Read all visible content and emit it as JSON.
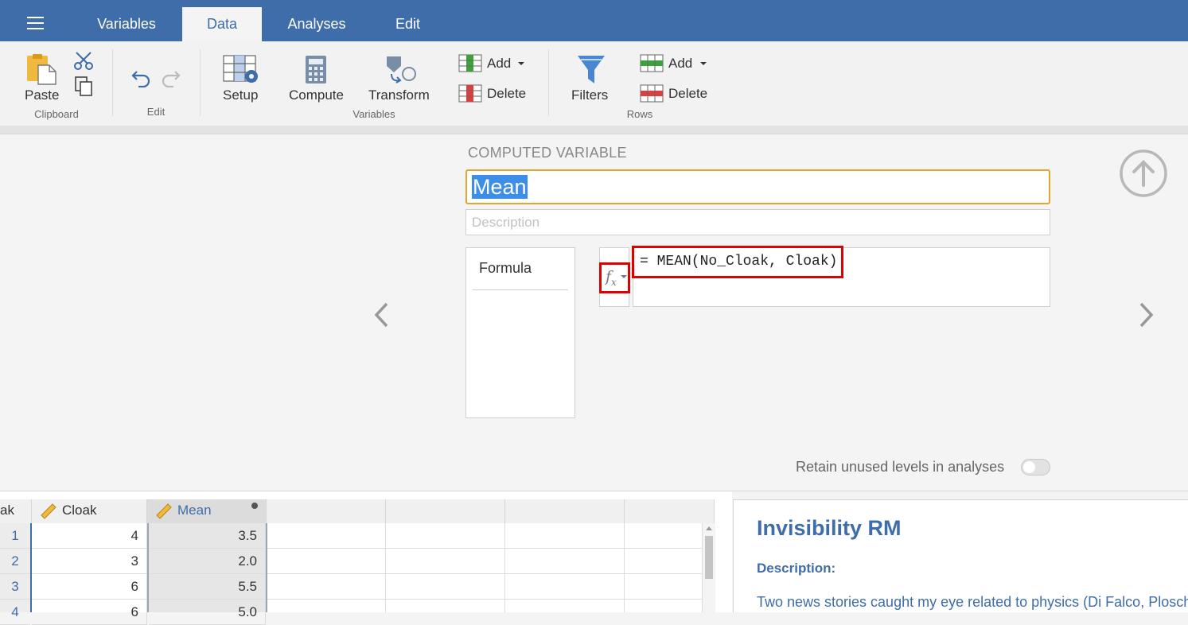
{
  "tabs": [
    {
      "label": "Variables"
    },
    {
      "label": "Data"
    },
    {
      "label": "Analyses"
    },
    {
      "label": "Edit"
    }
  ],
  "ribbon": {
    "paste": "Paste",
    "clipboard_group": "Clipboard",
    "edit_group": "Edit",
    "setup": "Setup",
    "compute": "Compute",
    "transform": "Transform",
    "var_add": "Add",
    "var_delete": "Delete",
    "variables_group": "Variables",
    "filters": "Filters",
    "row_add": "Add",
    "row_delete": "Delete",
    "rows_group": "Rows"
  },
  "editor": {
    "heading": "COMPUTED VARIABLE",
    "name_value": "Mean",
    "description_placeholder": "Description",
    "formula_tab": "Formula",
    "formula": "= MEAN(No_Cloak, Cloak)",
    "retain_label": "Retain unused levels in analyses",
    "retain_on": false
  },
  "grid": {
    "partial_col": "ak",
    "columns": [
      "Cloak",
      "Mean"
    ],
    "rows": [
      {
        "n": "1",
        "cloak": "4",
        "mean": "3.5"
      },
      {
        "n": "2",
        "cloak": "3",
        "mean": "2.0"
      },
      {
        "n": "3",
        "cloak": "6",
        "mean": "5.5"
      },
      {
        "n": "4",
        "cloak": "6",
        "mean": "5.0"
      }
    ]
  },
  "results": {
    "title": "Invisibility RM",
    "description_label": "Description:",
    "body": "Two news stories caught my eye related to physics (Di Falco, Ploschner"
  },
  "colors": {
    "brand": "#3e6da9",
    "highlight": "#e00000",
    "selection": "#3d8ee8",
    "focus": "#e0a62e"
  },
  "icons": [
    "menu-icon",
    "paste-icon",
    "cut-icon",
    "copy-icon",
    "undo-icon",
    "redo-icon",
    "setup-icon",
    "compute-icon",
    "transform-icon",
    "add-variable-icon",
    "delete-variable-icon",
    "filter-icon",
    "add-row-icon",
    "delete-row-icon",
    "upload-arrow-icon",
    "chevron-left-icon",
    "chevron-right-icon",
    "fx-icon",
    "ruler-icon"
  ]
}
